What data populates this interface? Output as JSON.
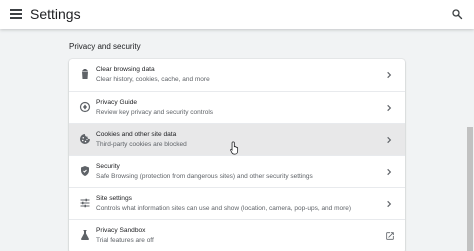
{
  "header": {
    "title": "Settings",
    "menu_icon": "hamburger-menu-icon",
    "search_icon": "search-icon"
  },
  "section": {
    "title": "Privacy and security"
  },
  "rows": [
    {
      "title": "Clear browsing data",
      "subtitle": "Clear history, cookies, cache, and more",
      "icon": "trash-icon",
      "action": "arrow"
    },
    {
      "title": "Privacy Guide",
      "subtitle": "Review key privacy and security controls",
      "icon": "privacy-guide-icon",
      "action": "arrow"
    },
    {
      "title": "Cookies and other site data",
      "subtitle": "Third-party cookies are blocked",
      "icon": "cookie-icon",
      "action": "arrow",
      "hovered": true
    },
    {
      "title": "Security",
      "subtitle": "Safe Browsing (protection from dangerous sites) and other security settings",
      "icon": "shield-icon",
      "action": "arrow"
    },
    {
      "title": "Site settings",
      "subtitle": "Controls what information sites can use and show (location, camera, pop-ups, and more)",
      "icon": "tune-sliders-icon",
      "action": "arrow"
    },
    {
      "title": "Privacy Sandbox",
      "subtitle": "Trial features are off",
      "icon": "flask-icon",
      "action": "external-link"
    }
  ],
  "colors": {
    "background": "#f1f3f4",
    "card": "#ffffff",
    "hover_row": "#e8e8e9",
    "icon": "#5f6368",
    "text_primary": "#202124",
    "text_secondary": "#5f6368"
  }
}
